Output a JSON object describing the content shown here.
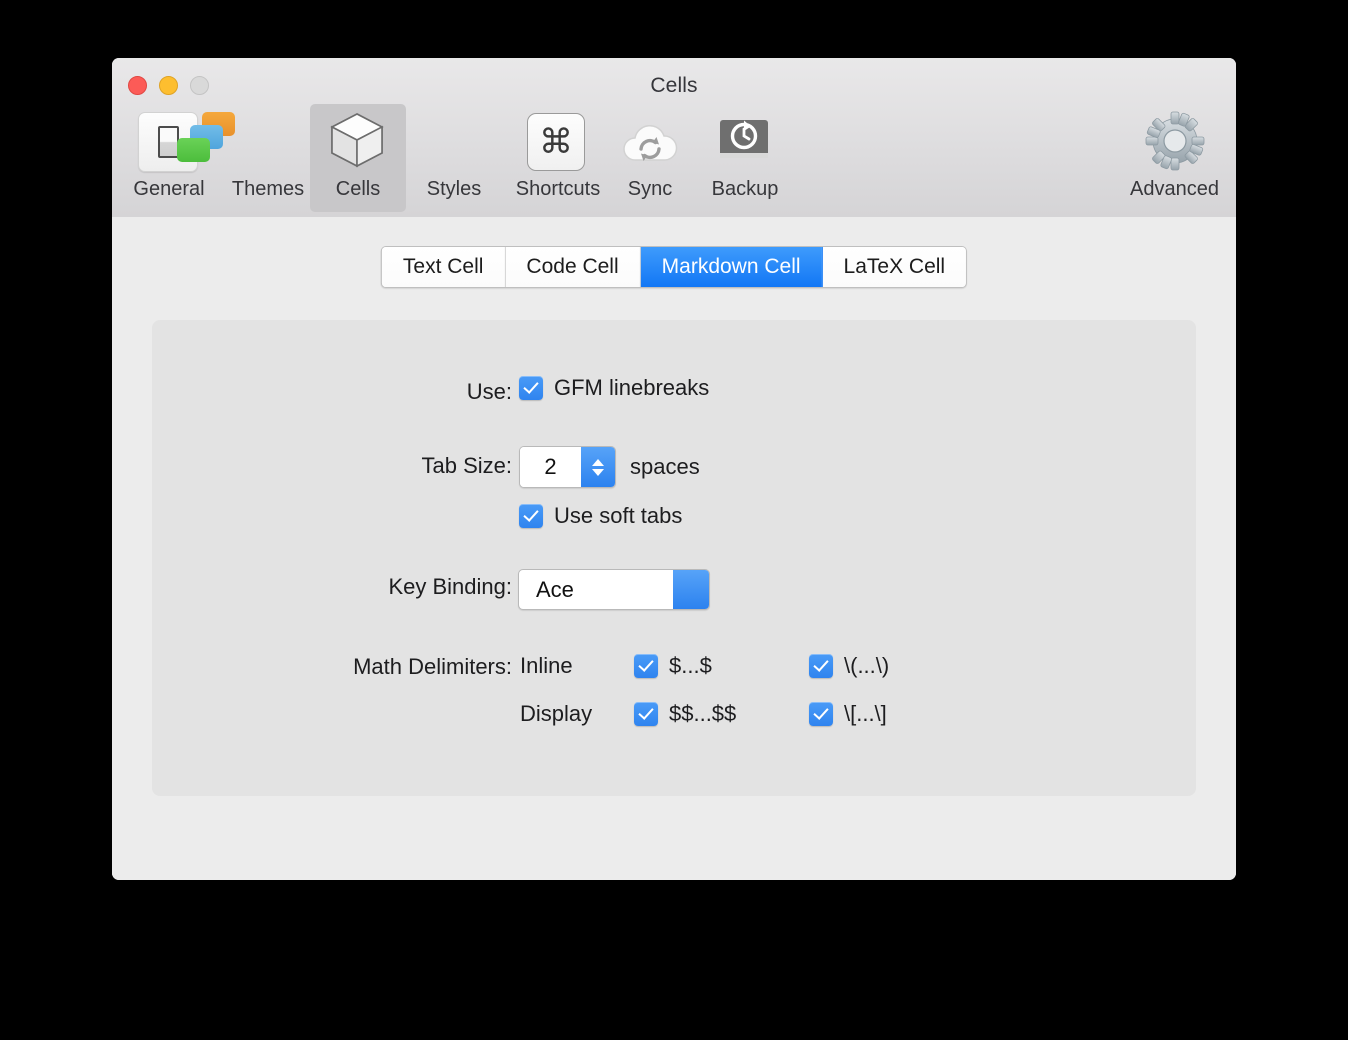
{
  "window": {
    "title": "Cells",
    "traffic_lights": [
      {
        "name": "close",
        "color": "#fc5b57"
      },
      {
        "name": "minimize",
        "color": "#fdbe2f"
      },
      {
        "name": "zoom",
        "color": "#d9d9d9"
      }
    ]
  },
  "toolbar": {
    "items": [
      {
        "label": "General",
        "icon": "toggle-switch-icon",
        "selected": false
      },
      {
        "label": "Themes",
        "icon": "stacked-cards-icon",
        "selected": false
      },
      {
        "label": "Cells",
        "icon": "cube-icon",
        "selected": true
      },
      {
        "label": "Styles",
        "icon": "color-wheel-icon",
        "selected": false
      },
      {
        "label": "Shortcuts",
        "icon": "command-key-icon",
        "selected": false
      },
      {
        "label": "Sync",
        "icon": "cloud-sync-icon",
        "selected": false
      },
      {
        "label": "Backup",
        "icon": "backup-drive-icon",
        "selected": false
      },
      {
        "label": "Advanced",
        "icon": "gear-icon",
        "selected": false
      }
    ],
    "command_glyph": "⌘"
  },
  "tabs": {
    "items": [
      {
        "label": "Text Cell",
        "active": false
      },
      {
        "label": "Code Cell",
        "active": false
      },
      {
        "label": "Markdown Cell",
        "active": true
      },
      {
        "label": "LaTeX Cell",
        "active": false
      }
    ],
    "active_color": "#1277f5"
  },
  "form": {
    "use": {
      "label": "Use:",
      "checkbox_label": "GFM linebreaks",
      "checked": true
    },
    "tab_size": {
      "label": "Tab Size:",
      "value": "2",
      "unit": "spaces"
    },
    "soft_tabs": {
      "checkbox_label": "Use soft tabs",
      "checked": true
    },
    "key_binding": {
      "label": "Key Binding:",
      "value": "Ace"
    },
    "math_delimiters": {
      "label": "Math Delimiters:",
      "rows": [
        {
          "kind": "Inline",
          "options": [
            {
              "text": "$...$",
              "checked": true
            },
            {
              "text": "\\(...\\)",
              "checked": true
            }
          ]
        },
        {
          "kind": "Display",
          "options": [
            {
              "text": "$$...$$",
              "checked": true
            },
            {
              "text": "\\[...\\]",
              "checked": true
            }
          ]
        }
      ]
    }
  }
}
